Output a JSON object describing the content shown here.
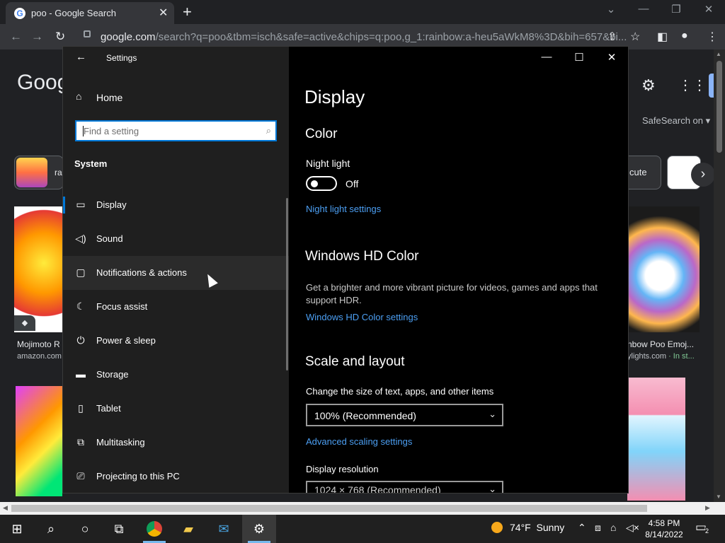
{
  "browser": {
    "tab_title": "poo - Google Search",
    "tab_close": "✕",
    "new_tab": "+",
    "win_min": "—",
    "win_restore": "❐",
    "win_close": "✕",
    "url_host": "google.com",
    "url_path": "/search?q=poo&tbm=isch&safe=active&chips=q:poo,g_1:rainbow:a-heu5aWkM8%3D&bih=657&bi..."
  },
  "google_page": {
    "logo": "Goog",
    "safesearch": "SafeSearch on",
    "chip1_text": "ra",
    "chip2_text": "cute",
    "result1_caption": "Mojimoto R",
    "result1_source": "amazon.com",
    "result2_caption": "nbow Poo Emoj...",
    "result2_source": "ylights.com",
    "result2_stock": " · In st..."
  },
  "settings": {
    "window_title": "Settings",
    "home_label": "Home",
    "search_placeholder": "Find a setting",
    "section": "System",
    "nav_items": [
      {
        "label": "Display",
        "icon": "display-icon"
      },
      {
        "label": "Sound",
        "icon": "sound-icon"
      },
      {
        "label": "Notifications & actions",
        "icon": "notifications-icon"
      },
      {
        "label": "Focus assist",
        "icon": "moon-icon"
      },
      {
        "label": "Power & sleep",
        "icon": "power-icon"
      },
      {
        "label": "Storage",
        "icon": "storage-icon"
      },
      {
        "label": "Tablet",
        "icon": "tablet-icon"
      },
      {
        "label": "Multitasking",
        "icon": "multitasking-icon"
      },
      {
        "label": "Projecting to this PC",
        "icon": "projecting-icon"
      }
    ],
    "content": {
      "title": "Display",
      "color_heading": "Color",
      "night_light_label": "Night light",
      "night_light_state": "Off",
      "night_light_link": "Night light settings",
      "hd_heading": "Windows HD Color",
      "hd_desc": "Get a brighter and more vibrant picture for videos, games and apps that support HDR.",
      "hd_link": "Windows HD Color settings",
      "scale_heading": "Scale and layout",
      "scale_label": "Change the size of text, apps, and other items",
      "scale_value": "100% (Recommended)",
      "scale_link": "Advanced scaling settings",
      "resolution_label": "Display resolution",
      "resolution_value": "1024 × 768 (Recommended)"
    }
  },
  "taskbar": {
    "temperature": "74°F",
    "condition": "Sunny",
    "time": "4:58 PM",
    "date": "8/14/2022",
    "notification_count": "2"
  },
  "colors": {
    "accent": "#0078d7",
    "link": "#4c9ff3",
    "chrome_dark": "#202124",
    "taskbar": "#202020"
  }
}
